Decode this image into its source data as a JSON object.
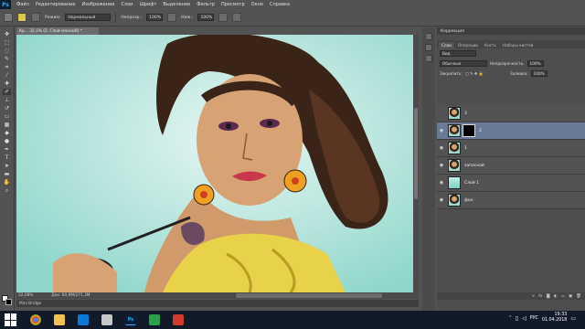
{
  "menubar": {
    "logo": "Ps",
    "items": [
      "Файл",
      "Редактирование",
      "Изображение",
      "Слои",
      "Шрифт",
      "Выделение",
      "Фильтр",
      "Просмотр",
      "Окно",
      "Справка"
    ]
  },
  "options": {
    "mode_label": "Режим:",
    "mode_value": "Нормальный",
    "opacity_label": "Непрозр.:",
    "opacity_value": "100%",
    "press_label": "Наж.:",
    "press_value": "100%"
  },
  "document": {
    "tab_title": "Кр... 32,1% (2, Слой-маска/8) *",
    "zoom": "32,08%",
    "size": "Док: 60,9M/271,3M",
    "mini_bridge": "Mini Bridge"
  },
  "panels": {
    "correction_title": "Коррекция",
    "tabs": [
      "Слои",
      "Операции",
      "Кисть",
      "Наборы кистей"
    ],
    "kind_value": "Вид",
    "blend_value": "Обычные",
    "opacity_label": "Непрозрачность:",
    "opacity_value": "100%",
    "lock_label": "Закрепить:",
    "fill_label": "Заливка:",
    "fill_value": "100%",
    "layers": [
      {
        "name": "3",
        "visible": false,
        "mask": false,
        "thumb": "portrait"
      },
      {
        "name": "2",
        "visible": true,
        "mask": true,
        "thumb": "portrait",
        "selected": true
      },
      {
        "name": "1",
        "visible": true,
        "mask": false,
        "thumb": "portrait"
      },
      {
        "name": "запасной",
        "visible": true,
        "mask": false,
        "thumb": "portrait"
      },
      {
        "name": "Слой 1",
        "visible": true,
        "mask": false,
        "thumb": "teal"
      },
      {
        "name": "фон",
        "visible": true,
        "mask": false,
        "thumb": "portrait"
      }
    ],
    "footer_icons": [
      "link-icon",
      "fx-icon",
      "mask-icon",
      "adjust-icon",
      "folder-icon",
      "new-layer-icon",
      "trash-icon"
    ]
  },
  "taskbar": {
    "lang": "РУС",
    "time": "19:33",
    "date": "01.04.2018"
  },
  "colors": {
    "accent_ps": "#31a8ff",
    "selected_layer": "#6a7a98",
    "canvas_bg": "#a9e0d8"
  }
}
